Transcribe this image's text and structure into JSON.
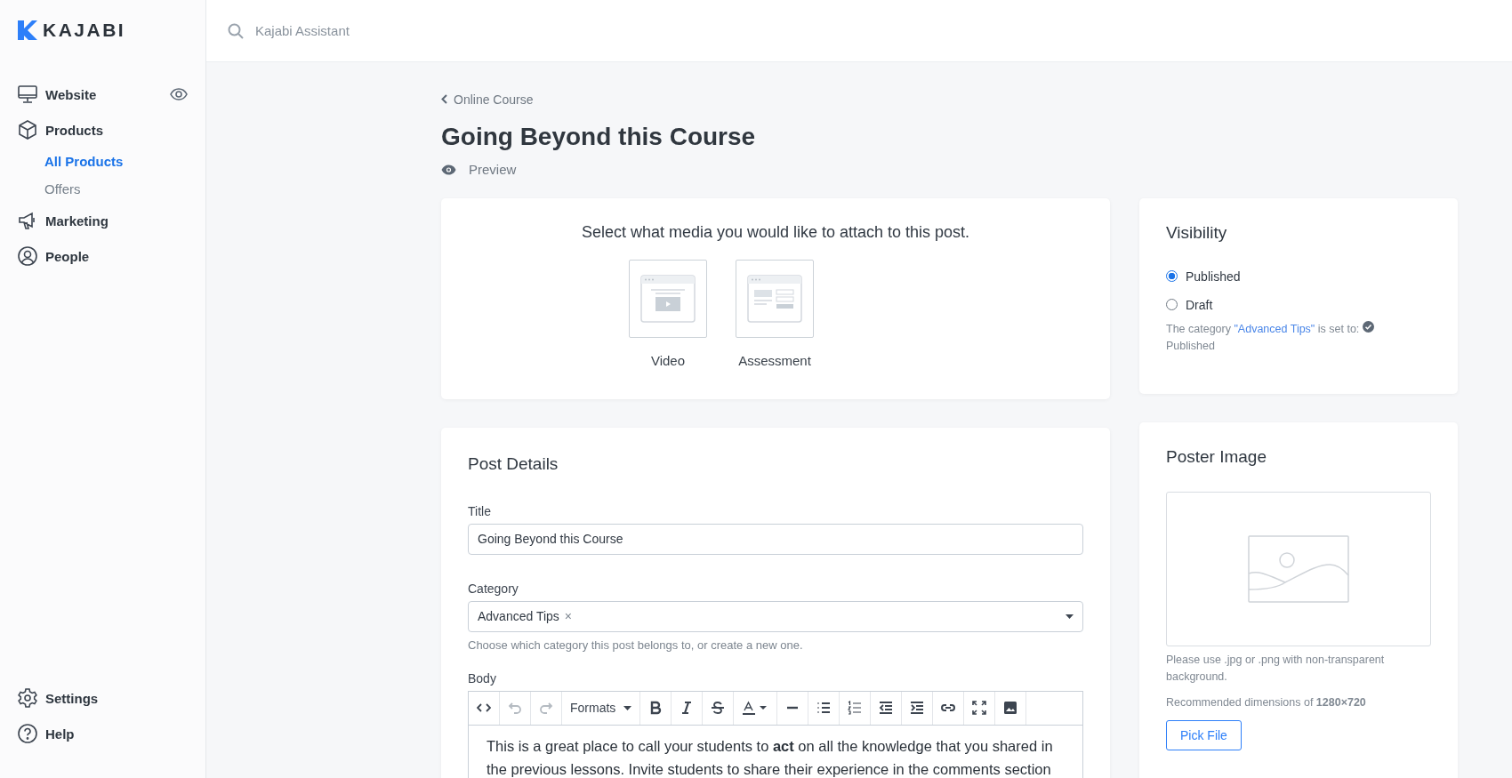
{
  "brand": {
    "name": "KAJABI"
  },
  "search": {
    "placeholder": "Kajabi Assistant"
  },
  "sidebar": {
    "items": [
      {
        "label": "Website"
      },
      {
        "label": "Products",
        "children": [
          {
            "label": "All Products",
            "selected": true
          },
          {
            "label": "Offers",
            "selected": false
          }
        ]
      },
      {
        "label": "Marketing"
      },
      {
        "label": "People"
      }
    ],
    "bottom_items": [
      {
        "label": "Settings"
      },
      {
        "label": "Help"
      }
    ]
  },
  "breadcrumb": "Online Course",
  "page_title": "Going Beyond this Course",
  "preview_link": "Preview",
  "media_card": {
    "prompt": "Select what media you would like to attach to this post.",
    "options": [
      {
        "label": "Video",
        "kind": "video"
      },
      {
        "label": "Assessment",
        "kind": "assessment"
      }
    ]
  },
  "post_details": {
    "heading": "Post Details",
    "title_field": {
      "label": "Title",
      "value": "Going Beyond this Course"
    },
    "category_field": {
      "label": "Category",
      "tag": "Advanced Tips",
      "remove": "×",
      "help": "Choose which category this post belongs to, or create a new one."
    },
    "body_field": {
      "label": "Body",
      "toolbar": [
        {
          "kind": "code",
          "disabled": false
        },
        {
          "kind": "undo",
          "disabled": true
        },
        {
          "kind": "redo",
          "disabled": true
        },
        {
          "kind": "formats",
          "label": "Formats",
          "disabled": false
        },
        {
          "kind": "bold",
          "disabled": false
        },
        {
          "kind": "italic",
          "disabled": false
        },
        {
          "kind": "strike",
          "disabled": false
        },
        {
          "kind": "color",
          "disabled": false
        },
        {
          "kind": "rule",
          "disabled": false
        },
        {
          "kind": "bullets",
          "disabled": false
        },
        {
          "kind": "numbers",
          "disabled": false
        },
        {
          "kind": "outdent",
          "disabled": false
        },
        {
          "kind": "indent",
          "disabled": false
        },
        {
          "kind": "link",
          "disabled": false
        },
        {
          "kind": "fullscreen",
          "disabled": false
        },
        {
          "kind": "image",
          "disabled": false
        }
      ],
      "text": "This is a great place to call your students to **act** on all the knowledge that you shared in the previous lessons. Invite students to share their experience in the comments section"
    }
  },
  "visibility": {
    "heading": "Visibility",
    "options": [
      {
        "label": "Published",
        "selected": true
      },
      {
        "label": "Draft",
        "selected": false
      }
    ],
    "note": {
      "before": "The category ",
      "link": "\"Advanced Tips\"",
      "after": " is set to:",
      "status": "Published"
    }
  },
  "poster": {
    "heading": "Poster Image",
    "help": "Please use .jpg or .png with non-transparent background.",
    "dimensions": "Recommended dimensions of **1280×720**",
    "button": "Pick File"
  }
}
